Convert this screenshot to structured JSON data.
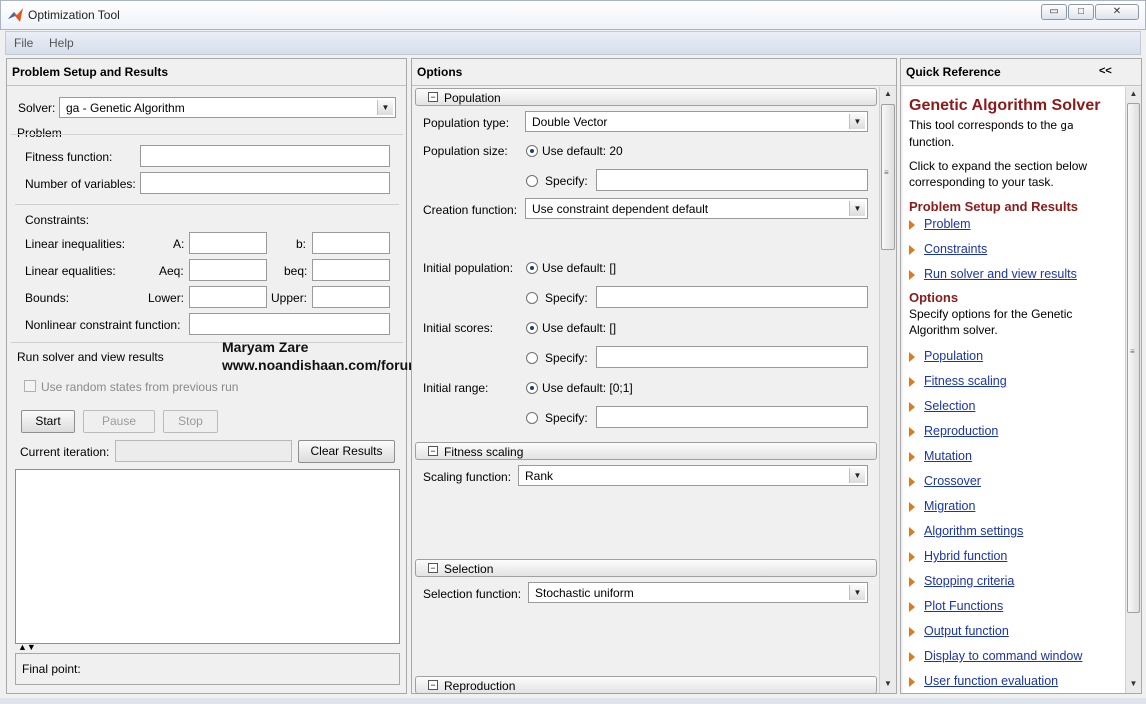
{
  "window": {
    "title": "Optimization Tool",
    "controls": [
      "▭",
      "□",
      "✕"
    ]
  },
  "menu": [
    "File",
    "Help"
  ],
  "left": {
    "header": "Problem Setup and Results",
    "solver_label": "Solver:",
    "solver_value": "ga - Genetic Algorithm",
    "problem_group": "Problem",
    "fitness_label": "Fitness function:",
    "nvars_label": "Number of variables:",
    "constraints_label": "Constraints:",
    "lin_ineq": "Linear inequalities:",
    "a_label": "A:",
    "b_label": "b:",
    "lin_eq": "Linear equalities:",
    "aeq_label": "Aeq:",
    "beq_label": "beq:",
    "bounds": "Bounds:",
    "lower_label": "Lower:",
    "upper_label": "Upper:",
    "nonlin": "Nonlinear constraint function:",
    "run_group": "Run solver and view results",
    "random_states": "Use random states from previous run",
    "start": "Start",
    "pause": "Pause",
    "stop": "Stop",
    "current_iteration": "Current iteration:",
    "clear_results": "Clear Results",
    "final_point": "Final point:"
  },
  "watermark": {
    "name": "Maryam Zare",
    "url": "www.noandishaan.com/forums"
  },
  "options": {
    "header": "Options",
    "population": {
      "title": "Population",
      "type_label": "Population type:",
      "type_value": "Double Vector",
      "size_label": "Population size:",
      "size_default": "Use default: 20",
      "specify": "Specify:",
      "creation_label": "Creation function:",
      "creation_value": "Use constraint dependent default",
      "init_pop_label": "Initial population:",
      "init_pop_default": "Use default: []",
      "init_scores_label": "Initial scores:",
      "init_scores_default": "Use default: []",
      "init_range_label": "Initial range:",
      "init_range_default": "Use default: [0;1]"
    },
    "fitness_scaling": {
      "title": "Fitness scaling",
      "label": "Scaling function:",
      "value": "Rank"
    },
    "selection": {
      "title": "Selection",
      "label": "Selection function:",
      "value": "Stochastic uniform"
    },
    "reproduction": {
      "title": "Reproduction"
    }
  },
  "quick_reference": {
    "header": "Quick Reference",
    "collapse": "<<",
    "title": "Genetic Algorithm Solver",
    "intro_1": "This tool corresponds to the",
    "intro_code": "ga",
    "intro_2": "function.",
    "intro_3": "Click to expand the section below corresponding to your task.",
    "psr_heading": "Problem Setup and Results",
    "psr_links": [
      "Problem",
      "Constraints",
      "Run solver and view results"
    ],
    "options_heading": "Options",
    "options_text": "Specify options for the Genetic Algorithm solver.",
    "options_links": [
      "Population",
      "Fitness scaling",
      "Selection",
      "Reproduction",
      "Mutation",
      "Crossover",
      "Migration",
      "Algorithm settings",
      "Hybrid function",
      "Stopping criteria",
      "Plot Functions",
      "Output function",
      "Display to command window",
      "User function evaluation"
    ]
  }
}
